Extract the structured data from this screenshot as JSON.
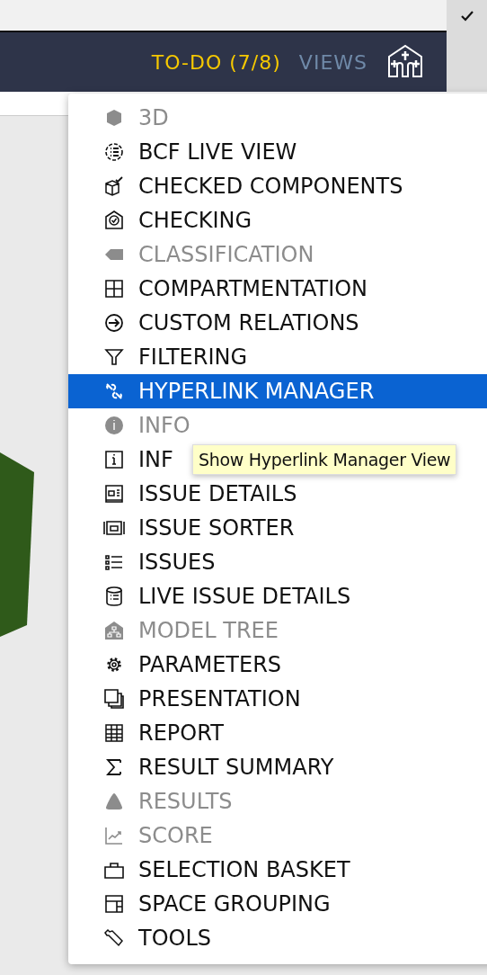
{
  "top_bar": {
    "todo": "TO-DO (7/8)",
    "views": "VIEWS"
  },
  "views_menu": {
    "items": [
      {
        "label": "3D",
        "disabled": true,
        "selected": false
      },
      {
        "label": "BCF LIVE VIEW",
        "disabled": false,
        "selected": false
      },
      {
        "label": "CHECKED COMPONENTS",
        "disabled": false,
        "selected": false
      },
      {
        "label": "CHECKING",
        "disabled": false,
        "selected": false
      },
      {
        "label": "CLASSIFICATION",
        "disabled": true,
        "selected": false
      },
      {
        "label": "COMPARTMENTATION",
        "disabled": false,
        "selected": false
      },
      {
        "label": "CUSTOM RELATIONS",
        "disabled": false,
        "selected": false
      },
      {
        "label": "FILTERING",
        "disabled": false,
        "selected": false
      },
      {
        "label": "HYPERLINK MANAGER",
        "disabled": false,
        "selected": true
      },
      {
        "label": "INFO",
        "disabled": true,
        "selected": false
      },
      {
        "label": "INF",
        "disabled": false,
        "selected": false
      },
      {
        "label": "ISSUE DETAILS",
        "disabled": false,
        "selected": false
      },
      {
        "label": "ISSUE SORTER",
        "disabled": false,
        "selected": false
      },
      {
        "label": "ISSUES",
        "disabled": false,
        "selected": false
      },
      {
        "label": "LIVE ISSUE DETAILS",
        "disabled": false,
        "selected": false
      },
      {
        "label": "MODEL TREE",
        "disabled": true,
        "selected": false
      },
      {
        "label": "PARAMETERS",
        "disabled": false,
        "selected": false
      },
      {
        "label": "PRESENTATION",
        "disabled": false,
        "selected": false
      },
      {
        "label": "REPORT",
        "disabled": false,
        "selected": false
      },
      {
        "label": "RESULT SUMMARY",
        "disabled": false,
        "selected": false
      },
      {
        "label": "RESULTS",
        "disabled": true,
        "selected": false
      },
      {
        "label": "SCORE",
        "disabled": true,
        "selected": false
      },
      {
        "label": "SELECTION BASKET",
        "disabled": false,
        "selected": false
      },
      {
        "label": "SPACE GROUPING",
        "disabled": false,
        "selected": false
      },
      {
        "label": "TOOLS",
        "disabled": false,
        "selected": false
      }
    ]
  },
  "tooltip": "Show Hyperlink Manager View"
}
